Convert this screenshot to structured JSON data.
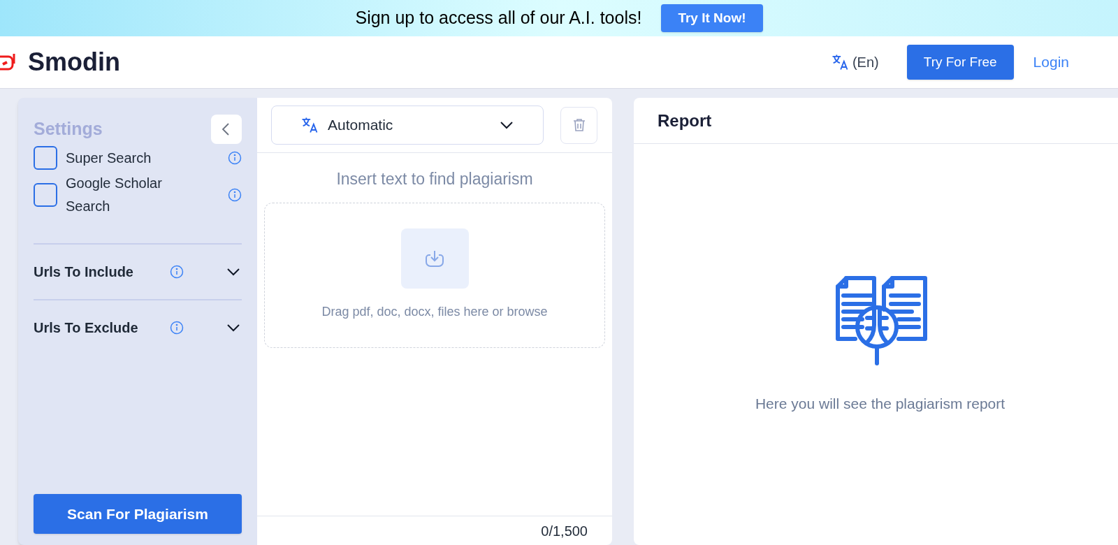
{
  "banner": {
    "text": "Sign up to access all of our A.I. tools!",
    "button": "Try It Now!"
  },
  "header": {
    "logo": "Smodin",
    "language": "(En)",
    "try_button": "Try For Free",
    "login": "Login"
  },
  "settings": {
    "title": "Settings",
    "options": [
      {
        "label": "Super Search",
        "checked": false
      },
      {
        "label": "Google Scholar Search",
        "checked": false
      }
    ],
    "sections": [
      {
        "label": "Urls To Include",
        "expanded": false
      },
      {
        "label": "Urls To Exclude",
        "expanded": false
      }
    ],
    "scan_button": "Scan For Plagiarism"
  },
  "editor": {
    "language": "Automatic",
    "prompt": "Insert text to find plagiarism",
    "dropzone": "Drag pdf, doc, docx, files here or browse",
    "counter": "0/1,500"
  },
  "report": {
    "title": "Report",
    "empty_text": "Here you will see the plagiarism report"
  }
}
